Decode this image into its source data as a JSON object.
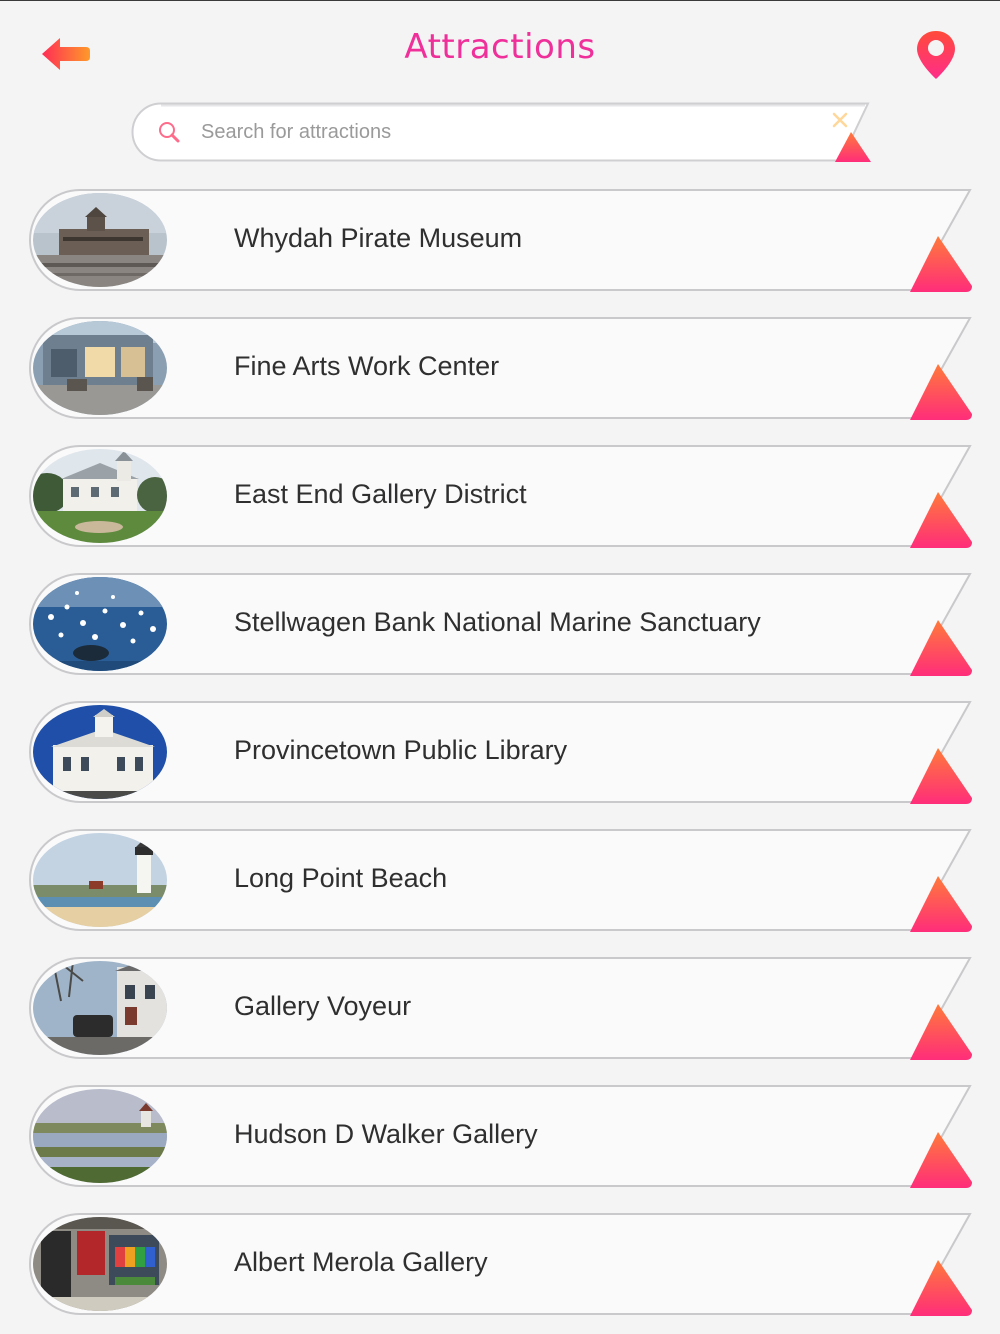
{
  "header": {
    "title": "Attractions",
    "back_icon": "back-arrow-icon",
    "map_icon": "map-pin-icon"
  },
  "search": {
    "placeholder": "Search for attractions",
    "value": "",
    "clear_icon": "close-icon"
  },
  "colors": {
    "accent_pink": "#f0309a",
    "gradient_start": "#ff2d7a",
    "gradient_end": "#ff9a2a",
    "list_text": "#2f2f2f",
    "background": "#f4f4f5"
  },
  "attractions": [
    {
      "name": "Whydah Pirate Museum",
      "thumbnail": "pier building photo"
    },
    {
      "name": "Fine Arts Work Center",
      "thumbnail": "building courtyard photo"
    },
    {
      "name": "East End Gallery District",
      "thumbnail": "victorian house photo"
    },
    {
      "name": "Stellwagen Bank National Marine Sanctuary",
      "thumbnail": "whale and birds photo"
    },
    {
      "name": "Provincetown Public Library",
      "thumbnail": "white library building photo"
    },
    {
      "name": "Long Point Beach",
      "thumbnail": "lighthouse beach photo"
    },
    {
      "name": "Gallery Voyeur",
      "thumbnail": "street photo"
    },
    {
      "name": "Hudson D Walker Gallery",
      "thumbnail": "marsh landscape photo"
    },
    {
      "name": "Albert Merola Gallery",
      "thumbnail": "storefront photo"
    }
  ]
}
